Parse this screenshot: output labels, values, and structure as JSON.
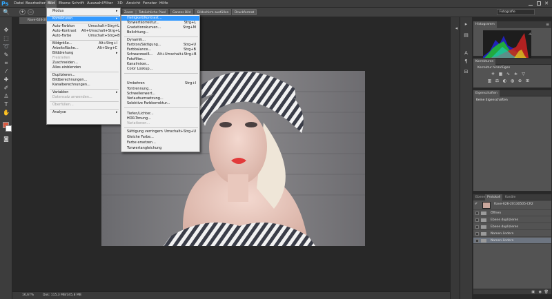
{
  "app": {
    "logo": "Ps"
  },
  "menubar": {
    "items": [
      "Datei",
      "Bearbeiten",
      "Bild",
      "Ebene",
      "Schrift",
      "Auswahl",
      "Filter",
      "3D",
      "Ansicht",
      "Fenster",
      "Hilfe"
    ]
  },
  "options": {
    "zoom_btn": "Zoom",
    "actual_pixels": "Tatsächliche Pixel",
    "fit_screen": "Ganzes Bild",
    "fill_screen": "Bildschirm ausfüllen",
    "print_size": "Druckformat",
    "workspace": "Fotografie"
  },
  "document": {
    "tab_title": "Rave-626-20130505-CR2"
  },
  "status": {
    "zoom": "16,67%",
    "doc_size": "Dok: 115,3 MB/345,8 MB"
  },
  "bild_menu": {
    "items": [
      {
        "label": "Modus",
        "shortcut": "",
        "submenu": true
      },
      {
        "label": "Korrekturen",
        "shortcut": "",
        "submenu": true,
        "highlight": true
      },
      {
        "label": "Auto-Farbton",
        "shortcut": "Umschalt+Strg+L"
      },
      {
        "label": "Auto-Kontrast",
        "shortcut": "Alt+Umschalt+Strg+L"
      },
      {
        "label": "Auto-Farbe",
        "shortcut": "Umschalt+Strg+B"
      },
      {
        "label": "Bildgröße...",
        "shortcut": "Alt+Strg+I"
      },
      {
        "label": "Arbeitsfläche...",
        "shortcut": "Alt+Strg+C"
      },
      {
        "label": "Bilddrehung",
        "shortcut": "",
        "submenu": true
      },
      {
        "label": "Freistellen",
        "shortcut": "",
        "disabled": true
      },
      {
        "label": "Zuschneiden...",
        "shortcut": ""
      },
      {
        "label": "Alles einblenden",
        "shortcut": ""
      },
      {
        "label": "Duplizieren...",
        "shortcut": ""
      },
      {
        "label": "Bildberechnungen...",
        "shortcut": ""
      },
      {
        "label": "Kanalberechnungen...",
        "shortcut": ""
      },
      {
        "label": "Variablen",
        "shortcut": "",
        "submenu": true
      },
      {
        "label": "Datensatz anwenden...",
        "shortcut": "",
        "disabled": true
      },
      {
        "label": "Überfüllen...",
        "shortcut": "",
        "disabled": true
      },
      {
        "label": "Analyse",
        "shortcut": "",
        "submenu": true
      }
    ]
  },
  "korrekturen_menu": {
    "items": [
      {
        "label": "Helligkeit/Kontrast...",
        "shortcut": "",
        "highlight": true
      },
      {
        "label": "Tonwertkorrektur...",
        "shortcut": "Strg+L"
      },
      {
        "label": "Gradationskurven...",
        "shortcut": "Strg+M"
      },
      {
        "label": "Belichtung...",
        "shortcut": ""
      },
      {
        "label": "Dynamik...",
        "shortcut": ""
      },
      {
        "label": "Farbton/Sättigung...",
        "shortcut": "Strg+U"
      },
      {
        "label": "Farbbalance...",
        "shortcut": "Strg+B"
      },
      {
        "label": "Schwarzweiß...",
        "shortcut": "Alt+Umschalt+Strg+B"
      },
      {
        "label": "Fotofilter...",
        "shortcut": ""
      },
      {
        "label": "Kanalmixer...",
        "shortcut": ""
      },
      {
        "label": "Color Lookup...",
        "shortcut": ""
      },
      {
        "label": "Umkehren",
        "shortcut": "Strg+I"
      },
      {
        "label": "Tontrennung...",
        "shortcut": ""
      },
      {
        "label": "Schwellenwert...",
        "shortcut": ""
      },
      {
        "label": "Verlaufsumsetzung...",
        "shortcut": ""
      },
      {
        "label": "Selektive Farbkorrektur...",
        "shortcut": ""
      },
      {
        "label": "Tiefen/Lichter...",
        "shortcut": ""
      },
      {
        "label": "HDR-Tonung...",
        "shortcut": ""
      },
      {
        "label": "Variationen...",
        "shortcut": "",
        "disabled": true
      },
      {
        "label": "Sättigung verringern",
        "shortcut": "Umschalt+Strg+U"
      },
      {
        "label": "Gleiche Farbe...",
        "shortcut": ""
      },
      {
        "label": "Farbe ersetzen...",
        "shortcut": ""
      },
      {
        "label": "Tonwertangleichung",
        "shortcut": ""
      }
    ]
  },
  "panels": {
    "histogram_tab": "Histogramm",
    "corrections_tab": "Korrekturen",
    "corrections_hint": "Korrektur hinzufügen",
    "properties_tab": "Eigenschaften",
    "properties_empty": "Keine Eigenschaften",
    "layers_tab": "Ebenen",
    "history_tab": "Protokoll",
    "channels_tab": "Kanäle"
  },
  "history": {
    "snapshot": "Rave-626-20130505-CR2",
    "items": [
      "Öffnen",
      "Ebene duplizieren",
      "Ebene duplizieren",
      "Namen ändern",
      "Namen ändern"
    ]
  },
  "colors": {
    "foreground": "#d95a41",
    "background": "#ffffff",
    "menu_highlight": "#3399ff",
    "history_selected": "#6d7581"
  }
}
